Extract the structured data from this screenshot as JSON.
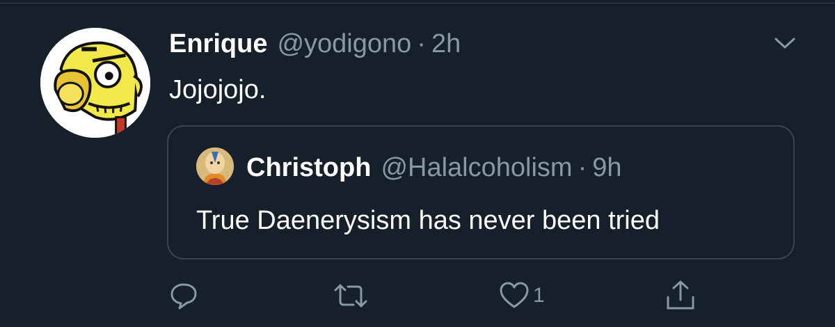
{
  "tweet": {
    "author_name": "Enrique",
    "author_handle": "@yodigono",
    "separator": "·",
    "time": "2h",
    "text": "Jojojojo."
  },
  "quoted": {
    "author_name": "Christoph",
    "author_handle": "@Halalcoholism",
    "separator": "·",
    "time": "9h",
    "text": "True Daenerysism has never been tried"
  },
  "actions": {
    "reply_icon": "reply-icon",
    "retweet_icon": "retweet-icon",
    "like_icon": "heart-icon",
    "like_count": "1",
    "share_icon": "share-icon"
  },
  "colors": {
    "background": "#15202b",
    "primary_text": "#ffffff",
    "secondary_text": "#8899a6",
    "border": "#38444d"
  }
}
